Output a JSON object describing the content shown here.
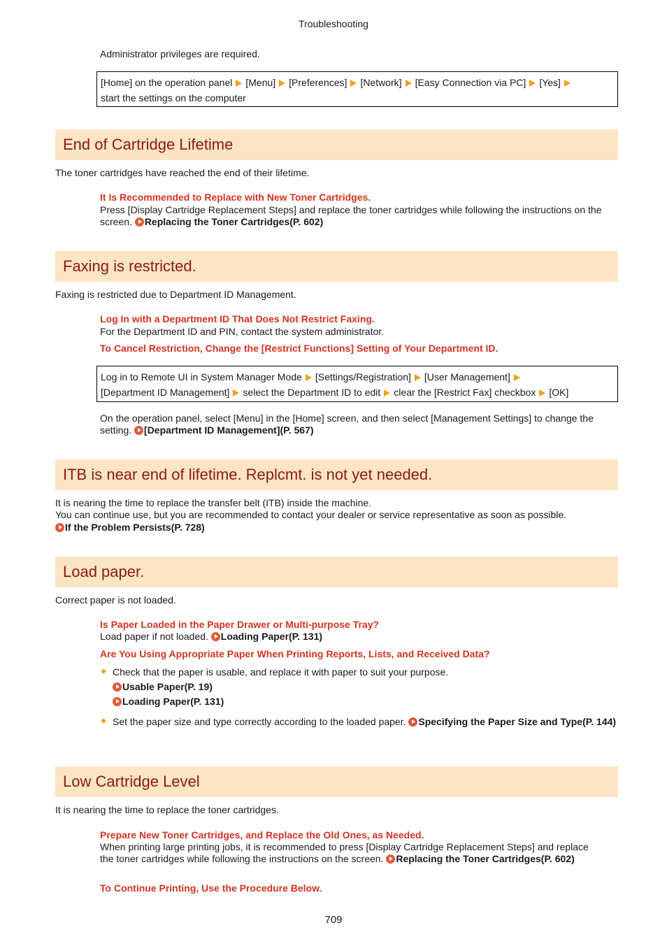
{
  "header": {
    "section": "Troubleshooting"
  },
  "intro": {
    "admin_note": "Administrator privileges are required.",
    "path": [
      "[Home] on the operation panel",
      "[Menu]",
      "[Preferences]",
      "[Network]",
      "[Easy Connection via PC]",
      "[Yes]",
      "start the settings on the computer"
    ]
  },
  "sections": [
    {
      "title": "End of Cartridge Lifetime",
      "desc": "The toner cartridges have reached the end of their lifetime.",
      "sub1_title": "It Is Recommended to Replace with New Toner Cartridges.",
      "sub1_text": "Press [Display Cartridge Replacement Steps] and replace the toner cartridges while following the instructions on the screen.",
      "sub1_link": "Replacing the Toner Cartridges(P. 602)"
    },
    {
      "title": "Faxing is restricted.",
      "desc": "Faxing is restricted due to Department ID Management.",
      "sub1_title": "Log In with a Department ID That Does Not Restrict Faxing.",
      "sub1_text": "For the Department ID and PIN, contact the system administrator.",
      "sub2_title": "To Cancel Restriction, Change the [Restrict Functions] Setting of Your Department ID.",
      "path": [
        "Log in to Remote UI in System Manager Mode",
        "[Settings/Registration]",
        "[User Management]",
        "[Department ID Management]",
        "select the Department ID to edit",
        "clear the [Restrict Fax] checkbox",
        "[OK]"
      ],
      "after_text": "On the operation panel, select [Menu] in the [Home] screen, and then select [Management Settings] to change the setting.",
      "after_link": "[Department ID Management](P. 567)"
    },
    {
      "title": "ITB is near end of lifetime. Replcmt. is not yet needed.",
      "desc1": "It is nearing the time to replace the transfer belt (ITB) inside the machine.",
      "desc2": "You can continue use, but you are recommended to contact your dealer or service representative as soon as possible.",
      "link": "If the Problem Persists(P. 728)"
    },
    {
      "title": "Load paper.",
      "desc": "Correct paper is not loaded.",
      "sub1_title": "Is Paper Loaded in the Paper Drawer or Multi-purpose Tray?",
      "sub1_text": "Load paper if not loaded.",
      "sub1_link": "Loading Paper(P. 131)",
      "sub2_title": "Are You Using Appropriate Paper When Printing Reports, Lists, and Received Data?",
      "bullet1_text": "Check that the paper is usable, and replace it with paper to suit your purpose.",
      "bullet1_link1": "Usable Paper(P. 19)",
      "bullet1_link2": "Loading Paper(P. 131)",
      "bullet2_text": "Set the paper size and type correctly according to the loaded paper.",
      "bullet2_link": "Specifying the Paper Size and Type(P. 144)"
    },
    {
      "title": "Low Cartridge Level",
      "desc": "It is nearing the time to replace the toner cartridges.",
      "sub1_title": "Prepare New Toner Cartridges, and Replace the Old Ones, as Needed.",
      "sub1_text": "When printing large printing jobs, it is recommended to press [Display Cartridge Replacement Steps] and replace the toner cartridges while following the instructions on the screen.",
      "sub1_link": "Replacing the Toner Cartridges(P. 602)",
      "sub2_title": "To Continue Printing, Use the Procedure Below."
    }
  ],
  "footer": {
    "page_number": "709"
  }
}
